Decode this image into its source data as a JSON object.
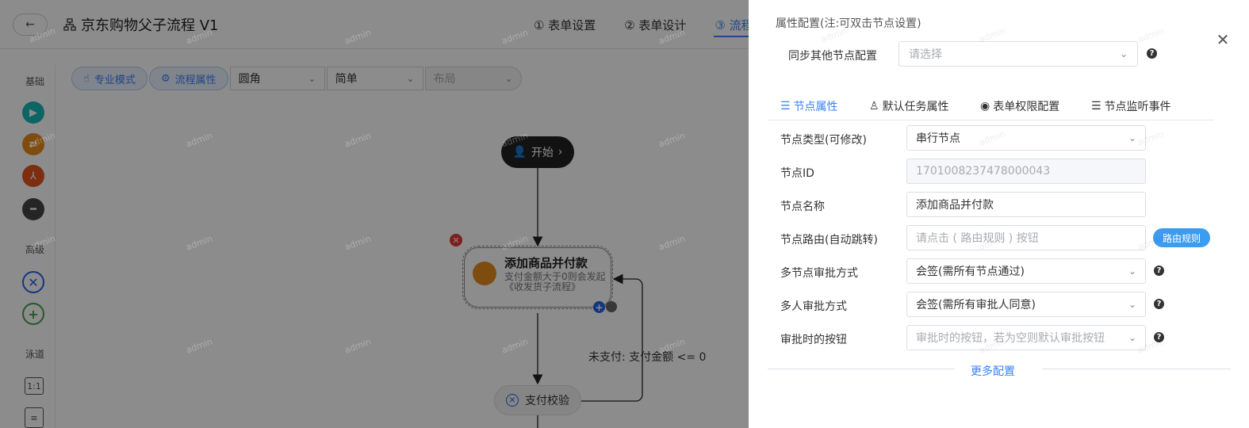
{
  "header": {
    "back_icon": "arrow-left-icon",
    "title": "京东购物父子流程 V1",
    "steps": [
      "① 表单设置",
      "② 表单设计",
      "③ 流程"
    ]
  },
  "sidebar": {
    "section_basic": "基础",
    "section_advanced": "高级",
    "section_lane": "泳道"
  },
  "toolbar": {
    "pro_mode": "专业模式",
    "flow_props": "流程属性",
    "select_corner": "圆角",
    "select_style": "简单",
    "select_layout": "布局"
  },
  "canvas": {
    "start_label": "开始",
    "task_title": "添加商品并付款",
    "task_desc": "支付金额大于0则会发起《收发货子流程》",
    "check_label": "支付校验",
    "edge_label": "未支付: 支付金额 <= 0",
    "watermark": "admin"
  },
  "drawer": {
    "title": "属性配置(注:可双击节点设置)",
    "sync_label": "同步其他节点配置",
    "sync_placeholder": "请选择",
    "tabs": [
      "节点属性",
      "默认任务属性",
      "表单权限配置",
      "节点监听事件"
    ],
    "rows": {
      "type_label": "节点类型(可修改)",
      "type_value": "串行节点",
      "id_label": "节点ID",
      "id_value": "1701008237478000043",
      "name_label": "节点名称",
      "name_value": "添加商品并付款",
      "route_label": "节点路由(自动跳转)",
      "route_placeholder": "请点击 ( 路由规则 ) 按钮",
      "route_button": "路由规则",
      "multi_node_label": "多节点审批方式",
      "multi_node_value": "会签(需所有节点通过)",
      "multi_user_label": "多人审批方式",
      "multi_user_value": "会签(需所有审批人同意)",
      "buttons_label": "审批时的按钮",
      "buttons_placeholder": "审批时的按钮，若为空则默认审批按钮"
    },
    "more": "更多配置"
  },
  "colors": {
    "accent": "#3b82f6",
    "mask": "rgba(0,0,0,0.45)",
    "start_node": "#222222",
    "task_icon": "#e88a1c",
    "delete": "#e53935"
  }
}
